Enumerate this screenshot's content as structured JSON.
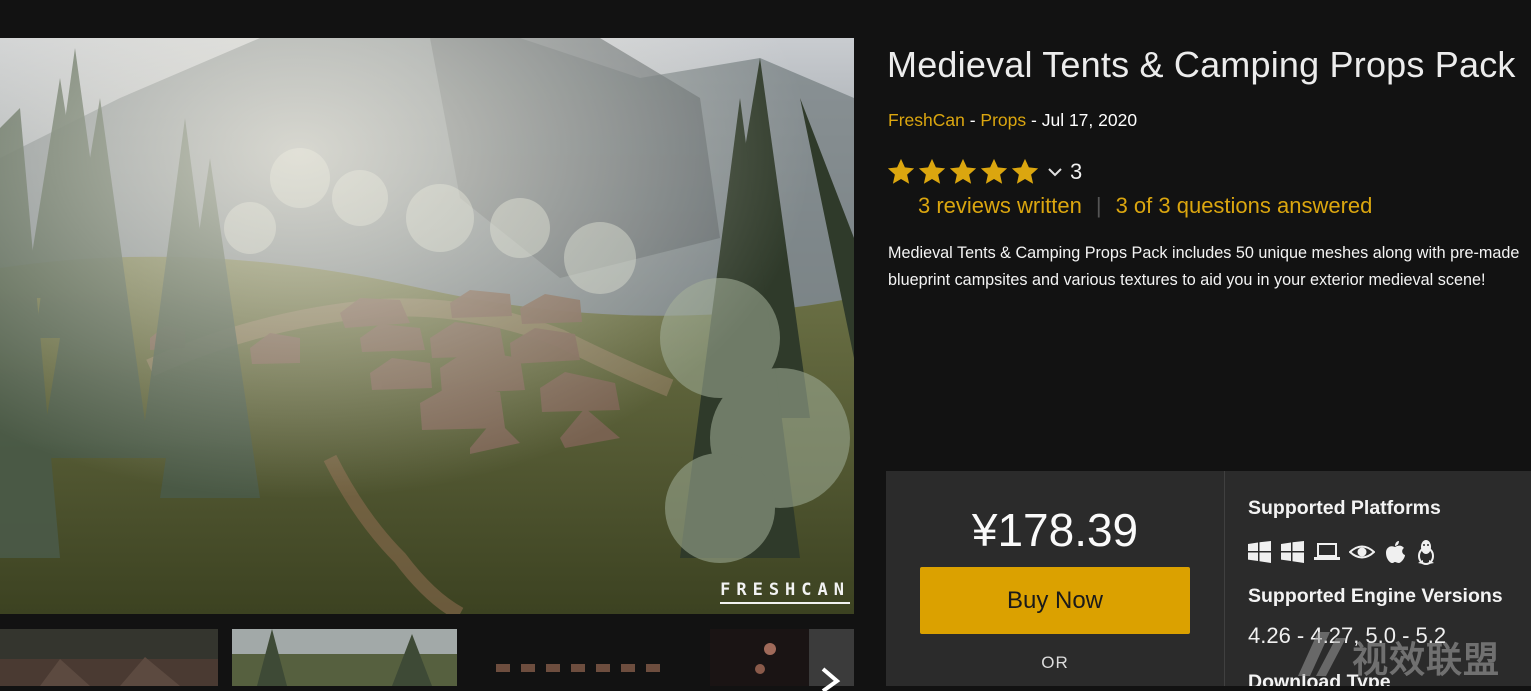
{
  "product": {
    "title": "Medieval Tents & Camping Props Pack",
    "seller": "FreshCan",
    "separator": "-",
    "category": "Props",
    "date": "Jul 17, 2020",
    "rating_stars": 5,
    "rating_count": "3",
    "reviews_link": "3 reviews written",
    "questions_link": "3 of 3 questions answered",
    "description": "Medieval Tents & Camping Props Pack includes 50 unique meshes along with pre-made blueprint campsites and various textures to aid you in your exterior medieval scene!"
  },
  "gallery": {
    "watermark": "FRESHCAN",
    "thumbnails": 4
  },
  "purchase": {
    "price": "¥178.39",
    "buy_label": "Buy Now",
    "or_label": "OR"
  },
  "specs": {
    "platforms_title": "Supported Platforms",
    "platform_icons": [
      "windows-icon",
      "windows-icon",
      "laptop-icon",
      "eye-icon",
      "apple-icon",
      "linux-icon"
    ],
    "engine_title": "Supported Engine Versions",
    "engine_versions": "4.26 - 4.27, 5.0 - 5.2",
    "download_title": "Download Type"
  },
  "overlay_watermark": {
    "text": "视效联盟"
  },
  "colors": {
    "accent": "#dba60f",
    "button": "#dba100",
    "background": "#121212",
    "panel": "#2b2b2b"
  }
}
